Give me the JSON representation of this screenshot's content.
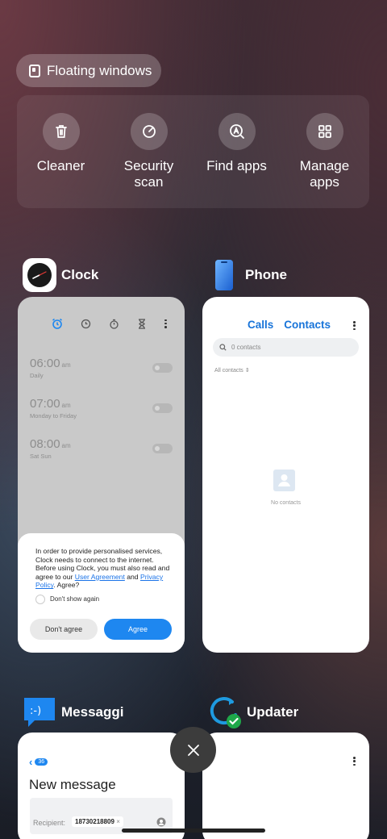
{
  "floating_windows": {
    "label": "Floating windows"
  },
  "tools": [
    {
      "label": "Cleaner",
      "icon": "trash-icon"
    },
    {
      "label": "Security\nscan",
      "icon": "security-scan-icon"
    },
    {
      "label": "Find apps",
      "icon": "find-apps-icon"
    },
    {
      "label": "Manage\napps",
      "icon": "grid-icon"
    }
  ],
  "apps": {
    "clock": {
      "name": "Clock",
      "alarms": [
        {
          "time": "06:00",
          "ampm": "am",
          "repeat": "Daily"
        },
        {
          "time": "07:00",
          "ampm": "am",
          "repeat": "Monday to Friday"
        },
        {
          "time": "08:00",
          "ampm": "am",
          "repeat": "Sat Sun"
        }
      ],
      "dialog": {
        "message_pre": "In order to provide personalised services, Clock needs to connect to the internet. Before using Clock, you must also read and agree to our ",
        "link_agreement": "User Agreement",
        "and": " and ",
        "link_privacy": "Privacy Policy",
        "message_post": ". Agree?",
        "checkbox_label": "Don't show again",
        "disagree": "Don't agree",
        "agree": "Agree"
      }
    },
    "phone": {
      "name": "Phone",
      "tabs": [
        "Calls",
        "Contacts"
      ],
      "search_placeholder": "0 contacts",
      "filter": "All contacts",
      "empty_text": "No contacts"
    },
    "messaggi": {
      "name": "Messaggi",
      "badge": "36",
      "title": "New message",
      "recipient_label": "Recipient:",
      "recipient_value": "18730218809"
    },
    "updater": {
      "name": "Updater"
    }
  },
  "colors": {
    "accent": "#1e87f0",
    "link": "#1874d9"
  }
}
